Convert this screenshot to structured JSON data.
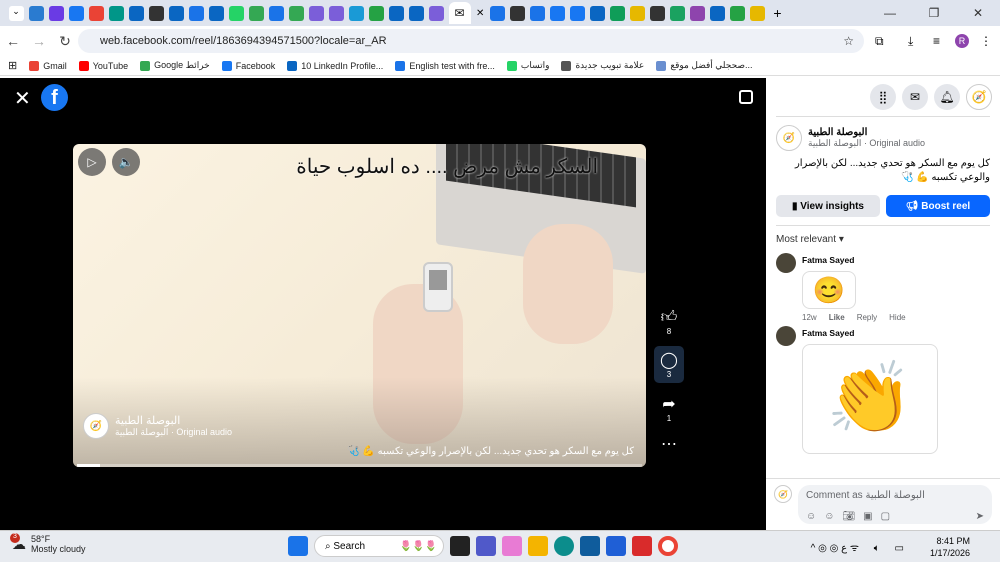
{
  "browser": {
    "tab_colors": [
      "#2a7bd0",
      "#6a3be4",
      "#1877f2",
      "#ea4335",
      "#009688",
      "#0a66c2",
      "#333333",
      "#0a66c2",
      "#1a73e8",
      "#0a66c2",
      "#25d366",
      "#34a853",
      "#1a73e8",
      "#34a853",
      "#7b5ed9",
      "#7b5ed9",
      "#1a9ad6",
      "#25a244",
      "#0a66c2",
      "#0a66c2",
      "#7b5ed9"
    ],
    "active_tab_icon": "envelope-icon",
    "tab_colors_right": [
      "#1a73e8",
      "#333333",
      "#1a73e8",
      "#1877f2",
      "#1877f2",
      "#0a66c2",
      "#0f9d58",
      "#e6b800",
      "#333333",
      "#1aa260",
      "#8e44ad",
      "#0a66c2",
      "#25a244",
      "#e6b800"
    ],
    "url": "web.facebook.com/reel/1863694394571500?locale=ar_AR",
    "bookmarks": [
      {
        "label": "Gmail",
        "color": "#ea4335"
      },
      {
        "label": "YouTube",
        "color": "#ff0000"
      },
      {
        "label": "Google خرائط",
        "color": "#34a853"
      },
      {
        "label": "Facebook",
        "color": "#1877f2"
      },
      {
        "label": "10 LinkedIn Profile...",
        "color": "#0a66c2"
      },
      {
        "label": "English test with fre...",
        "color": "#1a73e8"
      },
      {
        "label": "واتساب",
        "color": "#25d366"
      },
      {
        "label": "علامة تبويب جديدة",
        "color": "#555555"
      },
      {
        "label": "صحجلي أفضل موقع...",
        "color": "#6a8fd0"
      }
    ],
    "profile_initial": "R"
  },
  "reel": {
    "title_overlay": "السكر مش مرض .... ده اسلوب حياة",
    "page_name": "البوصلة الطبية",
    "audio": "البوصلة الطبية · Original audio",
    "caption": "كل يوم مع السكر هو تحدي جديد... لكن بالإصرار والوعي تكسبه 💪 🩺",
    "progress_percent": 4,
    "likes": "8",
    "comments": "3",
    "shares": "1"
  },
  "panel": {
    "page_name": "البوصلة الطبية",
    "audio": "البوصلة الطبية · Original audio",
    "caption": "كل يوم مع السكر هو تحدي جديد... لكن بالإصرار والوعي تكسبه 💪 🩺",
    "view_insights": "View insights",
    "boost_reel": "Boost reel",
    "sort": "Most relevant",
    "comments": [
      {
        "author": "Fatma Sayed",
        "sticker": "😊",
        "time": "12w",
        "like": "Like",
        "reply": "Reply",
        "hide": "Hide"
      },
      {
        "author": "Fatma Sayed",
        "sticker": "👏"
      }
    ],
    "comment_placeholder": "Comment as البوصلة الطبية"
  },
  "taskbar": {
    "temp": "58°F",
    "weather": "Mostly cloudy",
    "badge": "3",
    "search": "Search",
    "time": "8:41 PM",
    "date": "1/17/2026"
  }
}
